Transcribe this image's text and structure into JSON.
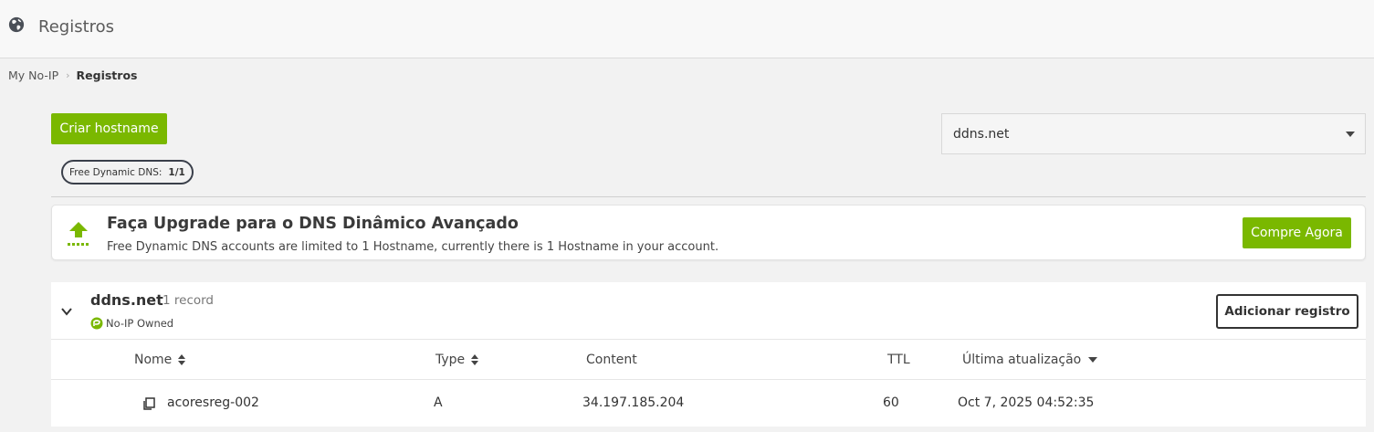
{
  "header": {
    "title": "Registros",
    "icon": "globe-icon"
  },
  "breadcrumb": {
    "root": "My No-IP",
    "current": "Registros"
  },
  "actions": {
    "create_hostname": "Criar hostname"
  },
  "quota": {
    "label": "Free Dynamic DNS:",
    "value": "1/1"
  },
  "domain_select": {
    "selected": "ddns.net"
  },
  "upgrade": {
    "title": "Faça Upgrade para o DNS Dinâmico Avançado",
    "text": "Free Dynamic DNS accounts are limited to 1 Hostname, currently there is 1 Hostname in your account.",
    "button": "Compre Agora"
  },
  "domain": {
    "name": "ddns.net",
    "record_count": "1 record",
    "ownership": "No-IP Owned",
    "add_button": "Adicionar registro"
  },
  "table": {
    "columns": [
      "Nome",
      "Type",
      "Content",
      "TTL",
      "Última atualização"
    ],
    "rows": [
      {
        "name": "acoresreg-002",
        "type": "A",
        "content": "34.197.185.204",
        "ttl": "60",
        "updated": "Oct 7, 2025 04:52:35"
      }
    ]
  },
  "colors": {
    "accent": "#7ab800",
    "dark": "#333333"
  }
}
